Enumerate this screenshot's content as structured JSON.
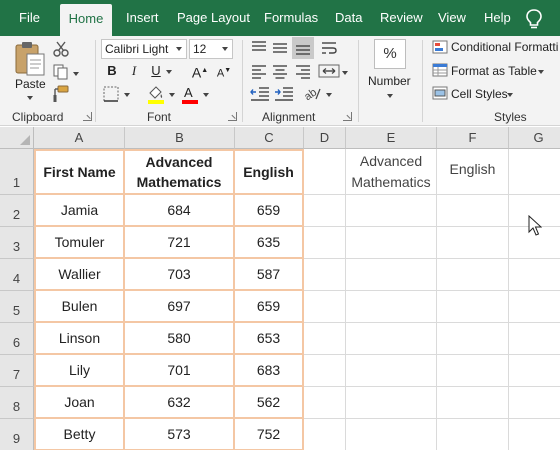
{
  "ribbon": {
    "tabs": [
      "File",
      "Home",
      "Insert",
      "Page Layout",
      "Formulas",
      "Data",
      "Review",
      "View",
      "Help"
    ],
    "active_tab": "Home",
    "clipboard": {
      "paste_label": "Paste",
      "group_label": "Clipboard"
    },
    "font": {
      "name": "Calibri Light",
      "size": "12",
      "group_label": "Font"
    },
    "alignment": {
      "group_label": "Alignment"
    },
    "number": {
      "label": "Number",
      "percent": "%"
    },
    "styles": {
      "conditional": "Conditional Formatti",
      "format_table": "Format as Table",
      "cell_styles": "Cell Styles",
      "group_label": "Styles"
    },
    "colors": {
      "ribbon_green": "#217346",
      "highlight": "#ffff00",
      "font_color": "#ff0000"
    }
  },
  "sheet": {
    "columns": [
      "A",
      "B",
      "C",
      "D",
      "E",
      "F",
      "G"
    ],
    "rows": [
      "1",
      "2",
      "3",
      "4",
      "5",
      "6",
      "7",
      "8",
      "9"
    ],
    "headers": {
      "a": "First Name",
      "b_line1": "Advanced",
      "b_line2": "Mathematics",
      "c": "English",
      "e_line1": "Advanced",
      "e_line2": "Mathematics",
      "f": "English"
    },
    "data": [
      [
        "Jamia",
        "684",
        "659"
      ],
      [
        "Tomuler",
        "721",
        "635"
      ],
      [
        "Wallier",
        "703",
        "587"
      ],
      [
        "Bulen",
        "697",
        "659"
      ],
      [
        "Linson",
        "580",
        "653"
      ],
      [
        "Lily",
        "701",
        "683"
      ],
      [
        "Joan",
        "632",
        "562"
      ],
      [
        "Betty",
        "573",
        "752"
      ]
    ],
    "border_color": "#f4c7a4"
  }
}
